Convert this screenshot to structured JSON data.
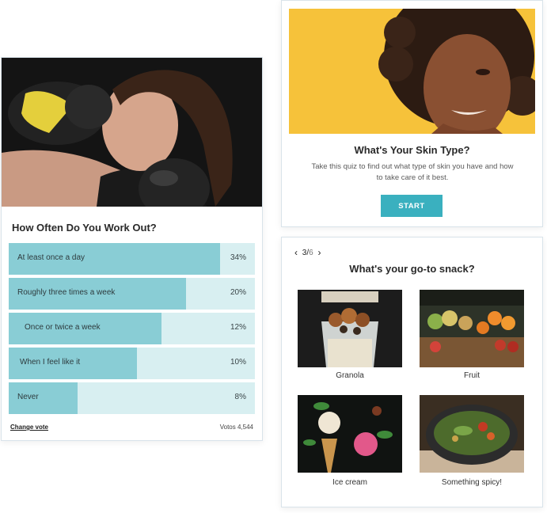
{
  "poll": {
    "title": "How Often Do You Work Out?",
    "options": [
      {
        "label": "At least once a day",
        "percent_text": "34%",
        "fill": 0.86
      },
      {
        "label": "Roughly three times a week",
        "percent_text": "20%",
        "fill": 0.72
      },
      {
        "label": "Once or twice a week",
        "percent_text": "12%",
        "fill": 0.62
      },
      {
        "label": "When I feel like it",
        "percent_text": "10%",
        "fill": 0.52
      },
      {
        "label": "Never",
        "percent_text": "8%",
        "fill": 0.28
      }
    ],
    "change_vote_label": "Change vote",
    "votes_text": "Votos 4,544"
  },
  "skin_quiz": {
    "title": "What's Your Skin Type?",
    "description": "Take this quiz to find out what type of skin you have and how to take care of it best.",
    "start_label": "START"
  },
  "snack_quiz": {
    "nav_current": "3/",
    "nav_total": "6",
    "title": "What's your go-to snack?",
    "options": [
      {
        "label": "Granola"
      },
      {
        "label": "Fruit"
      },
      {
        "label": "Ice cream"
      },
      {
        "label": "Something spicy!"
      }
    ]
  },
  "colors": {
    "accent": "#3ab0bf",
    "bar_fill": "#89cdd5",
    "bar_track": "#d8eff1",
    "skin_bg": "#f6c23a"
  }
}
